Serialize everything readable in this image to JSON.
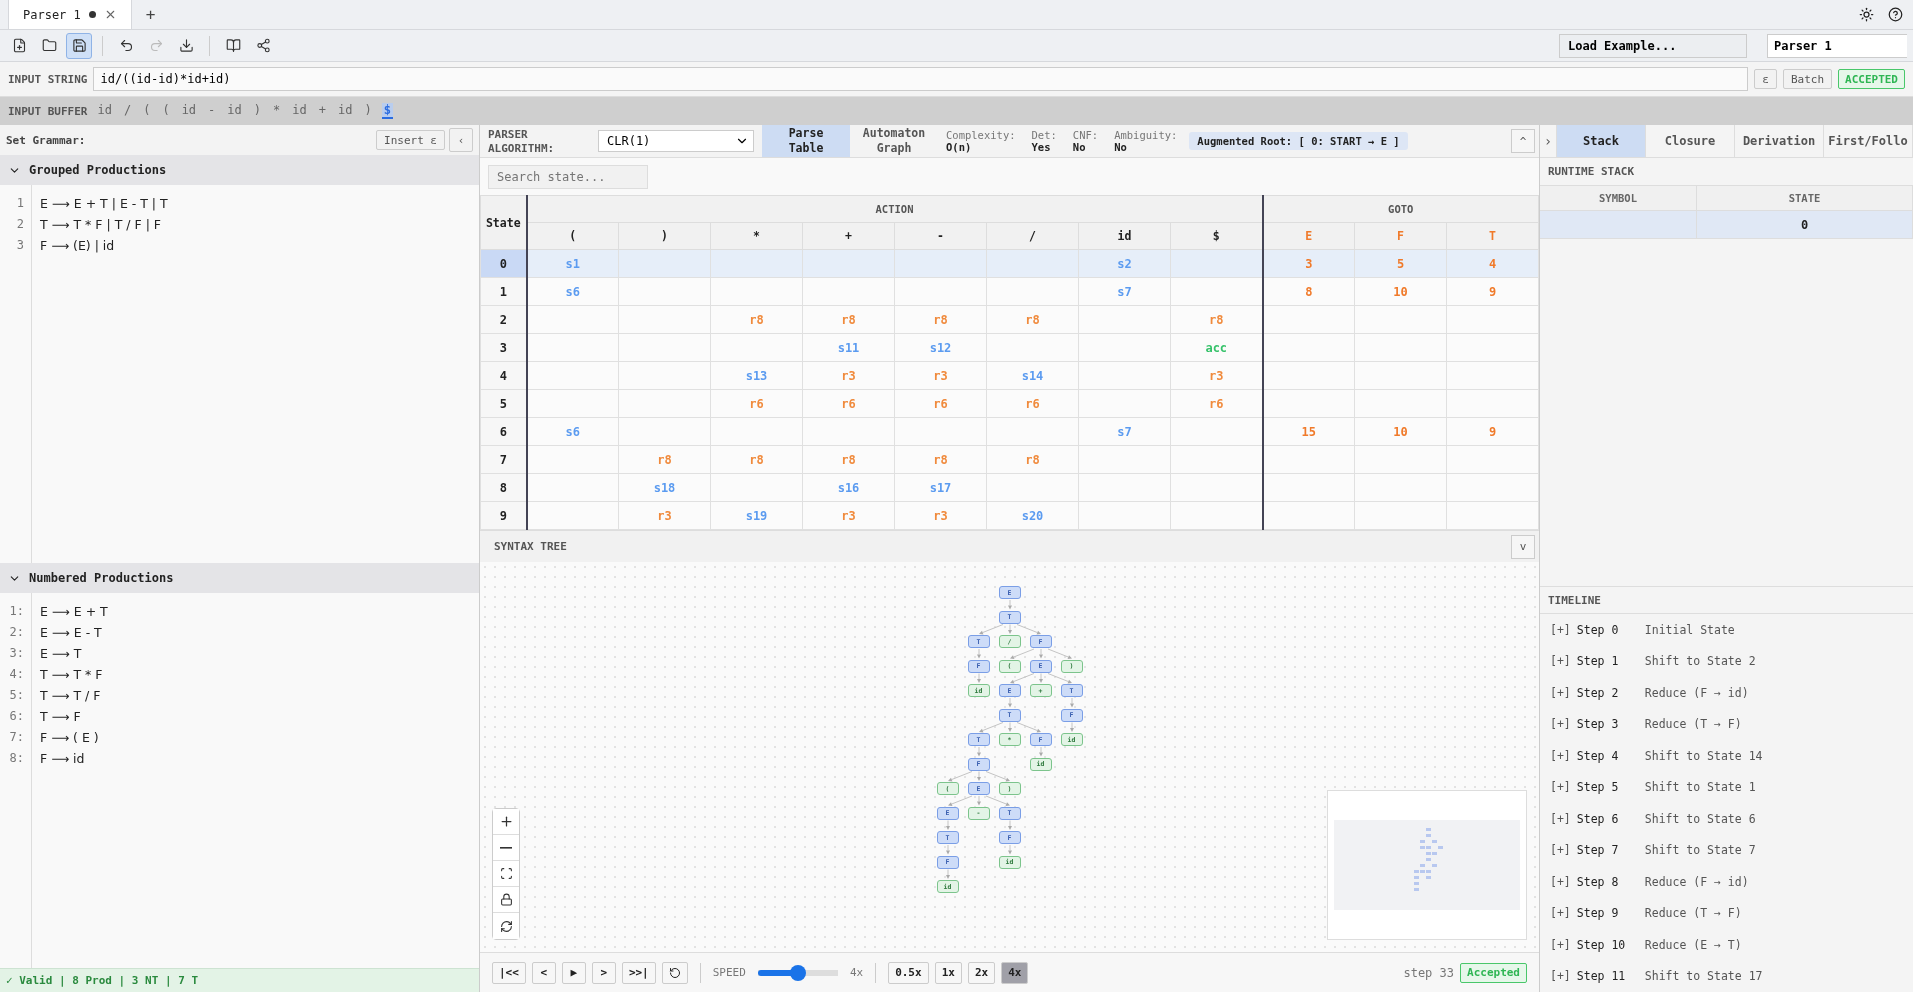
{
  "tabs": [
    {
      "title": "Parser 1",
      "modified": true,
      "selected": true
    }
  ],
  "new_tab": "+",
  "toolbar": [
    {
      "items": [
        {
          "kind": "new-file",
          "selected": false,
          "disabled": false
        },
        {
          "kind": "open",
          "selected": false,
          "disabled": false
        },
        {
          "kind": "save",
          "selected": true,
          "disabled": false
        }
      ]
    },
    {
      "items": [
        {
          "kind": "undo",
          "selected": false,
          "disabled": false
        },
        {
          "kind": "redo",
          "selected": false,
          "disabled": true
        },
        {
          "kind": "download",
          "selected": false,
          "disabled": false
        }
      ]
    },
    {
      "items": [
        {
          "kind": "book",
          "selected": false,
          "disabled": false
        },
        {
          "kind": "share",
          "selected": false,
          "disabled": false
        }
      ]
    }
  ],
  "load_example": "Load Example...",
  "parser_name": "Parser 1",
  "input_string": {
    "label": "INPUT STRING",
    "value": "id/((id-id)*id+id)",
    "epsilon": "ε",
    "batch": "Batch",
    "status": "ACCEPTED"
  },
  "input_buffer": {
    "label": "INPUT BUFFER",
    "tokens": [
      {
        "text": "id",
        "selected": false
      },
      {
        "text": "/",
        "selected": false
      },
      {
        "text": "(",
        "selected": false
      },
      {
        "text": "(",
        "selected": false
      },
      {
        "text": "id",
        "selected": false
      },
      {
        "text": "-",
        "selected": false
      },
      {
        "text": "id",
        "selected": false
      },
      {
        "text": ")",
        "selected": false
      },
      {
        "text": "*",
        "selected": false
      },
      {
        "text": "id",
        "selected": false
      },
      {
        "text": "+",
        "selected": false
      },
      {
        "text": "id",
        "selected": false
      },
      {
        "text": ")",
        "selected": false
      },
      {
        "text": "$",
        "selected": true
      }
    ]
  },
  "grammar": {
    "label": "Set Grammar:",
    "insert": "Insert ε",
    "collapse": "‹",
    "grouped": {
      "title": "Grouped Productions",
      "expanded": true,
      "lines": [
        {
          "number": "1",
          "text": "E ⟶ E + T | E - T | T"
        },
        {
          "number": "2",
          "text": "T ⟶ T * F | T / F | F"
        },
        {
          "number": "3",
          "text": "F ⟶ (E) | id"
        }
      ]
    },
    "numbered": {
      "title": "Numbered Productions",
      "expanded": true,
      "lines": [
        {
          "number": "1:",
          "text": "E ⟶ E + T"
        },
        {
          "number": "2:",
          "text": "E ⟶ E - T"
        },
        {
          "number": "3:",
          "text": "E ⟶ T"
        },
        {
          "number": "4:",
          "text": "T ⟶ T * F"
        },
        {
          "number": "5:",
          "text": "T ⟶ T / F"
        },
        {
          "number": "6:",
          "text": "T ⟶ F"
        },
        {
          "number": "7:",
          "text": "F ⟶ ( E )"
        },
        {
          "number": "8:",
          "text": "F ⟶ id"
        }
      ]
    },
    "status": "✓ Valid | 8 Prod | 3 NT | 7 T"
  },
  "center": {
    "algorithm_label": "PARSER ALGORITHM:",
    "algorithm": "CLR(1)",
    "views": [
      {
        "label": "Parse Table",
        "selected": true
      },
      {
        "label": "Automaton Graph",
        "selected": false
      }
    ],
    "stats": [
      {
        "label": "Complexity:",
        "value": "O(n)"
      },
      {
        "label": "Det:",
        "value": "Yes"
      },
      {
        "label": "CNF:",
        "value": "No"
      },
      {
        "label": "Ambiguity:",
        "value": "No"
      }
    ],
    "augmented_root": "Augmented Root: [ 0: START → E ]",
    "collapse": "^",
    "search": {
      "placeholder": "Search state..."
    }
  },
  "table": {
    "state_header": "State",
    "action_header": "ACTION",
    "goto_header": "GOTO",
    "action_columns": [
      "(",
      ")",
      "*",
      "+",
      "-",
      "/",
      "id",
      "$"
    ],
    "goto_columns": [
      "E",
      "F",
      "T"
    ],
    "rows": [
      {
        "state": "0",
        "selected": true,
        "cells": [
          {
            "text": "s1",
            "kind": "shift"
          },
          null,
          null,
          null,
          null,
          null,
          {
            "text": "s2",
            "kind": "shift"
          },
          null,
          {
            "text": "3",
            "kind": "goto"
          },
          {
            "text": "5",
            "kind": "goto"
          },
          {
            "text": "4",
            "kind": "goto"
          }
        ]
      },
      {
        "state": "1",
        "selected": false,
        "cells": [
          {
            "text": "s6",
            "kind": "shift"
          },
          null,
          null,
          null,
          null,
          null,
          {
            "text": "s7",
            "kind": "shift"
          },
          null,
          {
            "text": "8",
            "kind": "goto"
          },
          {
            "text": "10",
            "kind": "goto"
          },
          {
            "text": "9",
            "kind": "goto"
          }
        ]
      },
      {
        "state": "2",
        "selected": false,
        "cells": [
          null,
          null,
          {
            "text": "r8",
            "kind": "reduce"
          },
          {
            "text": "r8",
            "kind": "reduce"
          },
          {
            "text": "r8",
            "kind": "reduce"
          },
          {
            "text": "r8",
            "kind": "reduce"
          },
          null,
          {
            "text": "r8",
            "kind": "reduce"
          },
          null,
          null,
          null
        ]
      },
      {
        "state": "3",
        "selected": false,
        "cells": [
          null,
          null,
          null,
          {
            "text": "s11",
            "kind": "shift"
          },
          {
            "text": "s12",
            "kind": "shift"
          },
          null,
          null,
          {
            "text": "acc",
            "kind": "accept"
          },
          null,
          null,
          null
        ]
      },
      {
        "state": "4",
        "selected": false,
        "cells": [
          null,
          null,
          {
            "text": "s13",
            "kind": "shift"
          },
          {
            "text": "r3",
            "kind": "reduce"
          },
          {
            "text": "r3",
            "kind": "reduce"
          },
          {
            "text": "s14",
            "kind": "shift"
          },
          null,
          {
            "text": "r3",
            "kind": "reduce"
          },
          null,
          null,
          null
        ]
      },
      {
        "state": "5",
        "selected": false,
        "cells": [
          null,
          null,
          {
            "text": "r6",
            "kind": "reduce"
          },
          {
            "text": "r6",
            "kind": "reduce"
          },
          {
            "text": "r6",
            "kind": "reduce"
          },
          {
            "text": "r6",
            "kind": "reduce"
          },
          null,
          {
            "text": "r6",
            "kind": "reduce"
          },
          null,
          null,
          null
        ]
      },
      {
        "state": "6",
        "selected": false,
        "cells": [
          {
            "text": "s6",
            "kind": "shift"
          },
          null,
          null,
          null,
          null,
          null,
          {
            "text": "s7",
            "kind": "shift"
          },
          null,
          {
            "text": "15",
            "kind": "goto"
          },
          {
            "text": "10",
            "kind": "goto"
          },
          {
            "text": "9",
            "kind": "goto"
          }
        ]
      },
      {
        "state": "7",
        "selected": false,
        "cells": [
          null,
          {
            "text": "r8",
            "kind": "reduce"
          },
          {
            "text": "r8",
            "kind": "reduce"
          },
          {
            "text": "r8",
            "kind": "reduce"
          },
          {
            "text": "r8",
            "kind": "reduce"
          },
          {
            "text": "r8",
            "kind": "reduce"
          },
          null,
          null,
          null,
          null,
          null
        ]
      },
      {
        "state": "8",
        "selected": false,
        "cells": [
          null,
          {
            "text": "s18",
            "kind": "shift"
          },
          null,
          {
            "text": "s16",
            "kind": "shift"
          },
          {
            "text": "s17",
            "kind": "shift"
          },
          null,
          null,
          null,
          null,
          null,
          null
        ]
      },
      {
        "state": "9",
        "selected": false,
        "cells": [
          null,
          {
            "text": "r3",
            "kind": "reduce"
          },
          {
            "text": "s19",
            "kind": "shift"
          },
          {
            "text": "r3",
            "kind": "reduce"
          },
          {
            "text": "r3",
            "kind": "reduce"
          },
          {
            "text": "s20",
            "kind": "shift"
          },
          null,
          null,
          null,
          null,
          null
        ]
      }
    ]
  },
  "syntax_tree": {
    "title": "SYNTAX TREE",
    "collapse": "v",
    "root": {
      "label": "E",
      "kind": "nonterminal",
      "children": [
        {
          "label": "T",
          "kind": "nonterminal",
          "children": [
            {
              "label": "T",
              "kind": "nonterminal",
              "children": [
                {
                  "label": "F",
                  "kind": "nonterminal",
                  "children": [
                    {
                      "label": "id",
                      "kind": "terminal"
                    }
                  ]
                }
              ]
            },
            {
              "label": "/",
              "kind": "terminal"
            },
            {
              "label": "F",
              "kind": "nonterminal",
              "children": [
                {
                  "label": "(",
                  "kind": "terminal"
                },
                {
                  "label": "E",
                  "kind": "nonterminal",
                  "children": [
                    {
                      "label": "E",
                      "kind": "nonterminal",
                      "children": [
                        {
                          "label": "T",
                          "kind": "nonterminal",
                          "children": [
                            {
                              "label": "T",
                              "kind": "nonterminal",
                              "children": [
                                {
                                  "label": "F",
                                  "kind": "nonterminal",
                                  "children": [
                                    {
                                      "label": "(",
                                      "kind": "terminal"
                                    },
                                    {
                                      "label": "E",
                                      "kind": "nonterminal",
                                      "children": [
                                        {
                                          "label": "E",
                                          "kind": "nonterminal",
                                          "children": [
                                            {
                                              "label": "T",
                                              "kind": "nonterminal",
                                              "children": [
                                                {
                                                  "label": "F",
                                                  "kind": "nonterminal",
                                                  "children": [
                                                    {
                                                      "label": "id",
                                                      "kind": "terminal"
                                                    }
                                                  ]
                                                }
                                              ]
                                            }
                                          ]
                                        },
                                        {
                                          "label": "-",
                                          "kind": "terminal"
                                        },
                                        {
                                          "label": "T",
                                          "kind": "nonterminal",
                                          "children": [
                                            {
                                              "label": "F",
                                              "kind": "nonterminal",
                                              "children": [
                                                {
                                                  "label": "id",
                                                  "kind": "terminal"
                                                }
                                              ]
                                            }
                                          ]
                                        }
                                      ]
                                    },
                                    {
                                      "label": ")",
                                      "kind": "terminal"
                                    }
                                  ]
                                }
                              ]
                            },
                            {
                              "label": "*",
                              "kind": "terminal"
                            },
                            {
                              "label": "F",
                              "kind": "nonterminal",
                              "children": [
                                {
                                  "label": "id",
                                  "kind": "terminal"
                                }
                              ]
                            }
                          ]
                        }
                      ]
                    },
                    {
                      "label": "+",
                      "kind": "terminal"
                    },
                    {
                      "label": "T",
                      "kind": "nonterminal",
                      "children": [
                        {
                          "label": "F",
                          "kind": "nonterminal",
                          "children": [
                            {
                              "label": "id",
                              "kind": "terminal"
                            }
                          ]
                        }
                      ]
                    }
                  ]
                },
                {
                  "label": ")",
                  "kind": "terminal"
                }
              ]
            }
          ]
        }
      ]
    }
  },
  "playback": {
    "buttons": [
      "|<<",
      "<",
      "▶",
      ">",
      ">>|"
    ],
    "speed_label": "SPEED",
    "speed": {
      "level": 0.5
    },
    "speed_value": "4x",
    "rates": [
      {
        "label": "0.5x",
        "selected": false
      },
      {
        "label": "1x",
        "selected": false
      },
      {
        "label": "2x",
        "selected": false
      },
      {
        "label": "4x",
        "selected": true
      }
    ],
    "step": "step 33",
    "result": "Accepted"
  },
  "right": {
    "collapse": "›",
    "tabs": [
      {
        "label": "Stack",
        "selected": true
      },
      {
        "label": "Closure",
        "selected": false
      },
      {
        "label": "Derivation",
        "selected": false
      },
      {
        "label": "First/Follo",
        "selected": false
      }
    ],
    "runtime_stack": {
      "title": "RUNTIME STACK",
      "columns": [
        "SYMBOL",
        "STATE"
      ],
      "rows": [
        {
          "state": "0",
          "selected": true
        }
      ]
    },
    "timeline": {
      "title": "TIMELINE",
      "items": [
        {
          "toggle": "[+]",
          "step": "Step 0",
          "label": "Initial State"
        },
        {
          "toggle": "[+]",
          "step": "Step 1",
          "label": "Shift to State 2"
        },
        {
          "toggle": "[+]",
          "step": "Step 2",
          "label": "Reduce (F → id)"
        },
        {
          "toggle": "[+]",
          "step": "Step 3",
          "label": "Reduce (T → F)"
        },
        {
          "toggle": "[+]",
          "step": "Step 4",
          "label": "Shift to State 14"
        },
        {
          "toggle": "[+]",
          "step": "Step 5",
          "label": "Shift to State 1"
        },
        {
          "toggle": "[+]",
          "step": "Step 6",
          "label": "Shift to State 6"
        },
        {
          "toggle": "[+]",
          "step": "Step 7",
          "label": "Shift to State 7"
        },
        {
          "toggle": "[+]",
          "step": "Step 8",
          "label": "Reduce (F → id)"
        },
        {
          "toggle": "[+]",
          "step": "Step 9",
          "label": "Reduce (T → F)"
        },
        {
          "toggle": "[+]",
          "step": "Step 10",
          "label": "Reduce (E → T)"
        },
        {
          "toggle": "[+]",
          "step": "Step 11",
          "label": "Shift to State 17"
        }
      ]
    }
  }
}
